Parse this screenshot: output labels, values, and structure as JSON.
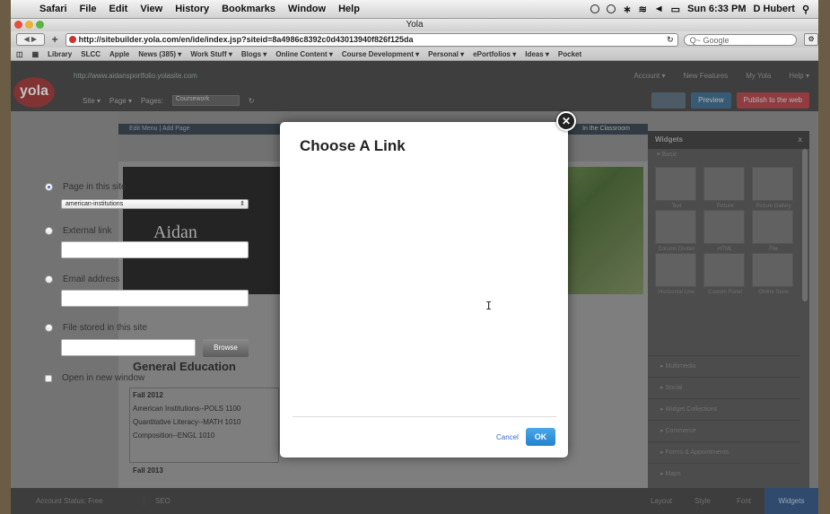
{
  "menubar": {
    "apple": "",
    "items": [
      "Safari",
      "File",
      "Edit",
      "View",
      "History",
      "Bookmarks",
      "Window",
      "Help"
    ],
    "clock": "Sun 6:33 PM",
    "user": "D Hubert"
  },
  "window": {
    "title": "Yola"
  },
  "toolbar": {
    "url": "http://sitebuilder.yola.com/en/ide/index.jsp?siteid=8a4986c8392c0d43013940f826f125da",
    "search_placeholder": "Q~ Google"
  },
  "bookmarks": [
    "Library",
    "SLCC",
    "Apple",
    "News (385) ▾",
    "Work Stuff ▾",
    "Blogs ▾",
    "Online Content ▾",
    "Course Development ▾",
    "Personal ▾",
    "ePortfolios ▾",
    "Ideas ▾",
    "Pocket"
  ],
  "yola": {
    "logo": "yola",
    "site_url": "http://www.aidansportfolio.yolasite.com",
    "top_links": [
      "Account ▾",
      "New Features",
      "My Yola",
      "Help ▾"
    ],
    "site_menu": "Site ▾",
    "page_menu": "Page ▾",
    "pages_label": "Pages:",
    "pages_value": "Coursework",
    "preview": "Preview",
    "publish": "Publish to the web"
  },
  "editor": {
    "edit_menu": "Edit Menu  |  Add Page",
    "nav_item": "In the Classroom",
    "site_name": "Aidan",
    "section_title": "General Education",
    "courses": [
      "Fall 2012",
      "American Institutions--POLS 1100",
      "Quantitative Literacy--MATH 1010",
      "Composition--ENGL 1010"
    ],
    "fall2013": "Fall 2013"
  },
  "widgets": {
    "title": "Widgets",
    "close": "x",
    "section_basic": "▾ Basic",
    "tiles": [
      "Text",
      "Picture",
      "Picture Gallery",
      "Column Divider",
      "HTML",
      "File",
      "Horizontal Line",
      "Custom Panel",
      "Online Store"
    ],
    "categories": [
      "▸ Multimedia",
      "▸ Social",
      "▸ Widget Collections",
      "▸ Commerce",
      "▸ Forms & Appointments",
      "▸ Maps"
    ]
  },
  "bottombar": {
    "account_status": "Account Status: Free",
    "seo": "SEO",
    "tabs": [
      "Layout",
      "Style",
      "Font",
      "Widgets"
    ]
  },
  "dialog": {
    "title": "Choose A Link",
    "close_glyph": "✕",
    "options": {
      "page": "Page in this site",
      "external": "External link",
      "email": "Email address",
      "file": "File stored in this site",
      "new_window": "Open in new window"
    },
    "page_select_value": "american-institutions",
    "external_value": "",
    "email_value": "",
    "file_value": "",
    "browse": "Browse",
    "cancel": "Cancel",
    "ok": "OK"
  },
  "colors": {
    "ok_button": "#2282cc",
    "cancel_link": "#3a6cc8",
    "yola_logo": "#9e3d3d",
    "publish_button": "#b04a4f"
  }
}
